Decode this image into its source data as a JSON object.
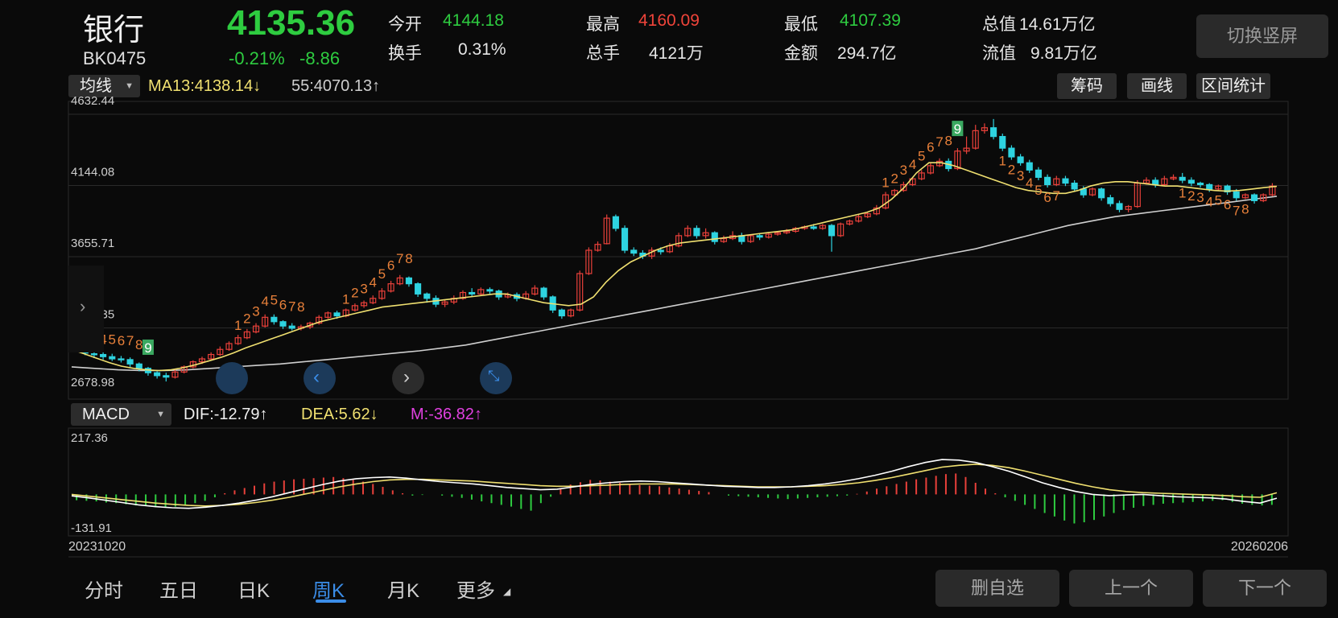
{
  "header": {
    "name": "银行",
    "code": "BK0475",
    "price": "4135.36",
    "change_pct": "-0.21%",
    "change_abs": "-8.86",
    "stats": [
      {
        "label": "今开",
        "value": "4144.18",
        "color": "#2ecc40"
      },
      {
        "label": "换手",
        "value": "0.31%",
        "color": "#e6e6e6"
      },
      {
        "label": "最高",
        "value": "4160.09",
        "color": "#f0443a"
      },
      {
        "label": "总手",
        "value": "4121万",
        "color": "#e6e6e6"
      },
      {
        "label": "最低",
        "value": "4107.39",
        "color": "#2ecc40"
      },
      {
        "label": "金额",
        "value": "294.7亿",
        "color": "#e6e6e6"
      },
      {
        "label": "总值",
        "value": "14.61万亿",
        "color": "#e6e6e6"
      },
      {
        "label": "流值",
        "value": "9.81万亿",
        "color": "#e6e6e6"
      }
    ],
    "rotate_button": "切换竖屏"
  },
  "toolbar": {
    "indicator_select": "均线",
    "ma13": "MA13:4138.14",
    "ma13_arrow": "↓",
    "ma55": "55:4070.13",
    "ma55_arrow": "↑",
    "buttons": [
      "筹码",
      "画线",
      "区间统计"
    ]
  },
  "macd_toolbar": {
    "select": "MACD",
    "dif": "DIF:-12.79",
    "dif_arrow": "↑",
    "dea": "DEA:5.62",
    "dea_arrow": "↓",
    "m": "M:-36.82",
    "m_arrow": "↑"
  },
  "nav": {
    "tabs": [
      "分时",
      "五日",
      "日K",
      "周K",
      "月K",
      "更多"
    ],
    "active": "周K",
    "buttons": [
      "删自选",
      "上一个",
      "下一个"
    ]
  },
  "colors": {
    "up": "#e8403a",
    "down": "#2ed3e0",
    "ma13": "#f0e070",
    "ma55": "#cfcfcf",
    "dif": "#ffffff",
    "dea": "#f0e070",
    "macd_up": "#e8403a",
    "macd_down": "#2ecc40",
    "magenta": "#e040e0",
    "yellow": "#f0e070"
  },
  "chart_data": [
    {
      "type": "candlestick",
      "title": "",
      "y_ticks": [
        "4632.44",
        "4144.08",
        "3655.71",
        "3167.35",
        "2678.98"
      ],
      "ylim": [
        2678.98,
        4632.44
      ],
      "x_start": "20231020",
      "x_end": "20260206",
      "grid": true,
      "series": [
        {
          "name": "MA13",
          "value": 4138.14
        },
        {
          "name": "55",
          "value": 4070.13
        }
      ],
      "candles_ohlc": [
        [
          3060,
          3040,
          3000,
          3070
        ],
        [
          3030,
          2995,
          2980,
          3045
        ],
        [
          2990,
          2985,
          2960,
          3010
        ],
        [
          2985,
          2970,
          2950,
          3000
        ],
        [
          2970,
          2955,
          2940,
          2990
        ],
        [
          2955,
          2950,
          2930,
          2975
        ],
        [
          2950,
          2920,
          2900,
          2965
        ],
        [
          2920,
          2890,
          2870,
          2930
        ],
        [
          2890,
          2860,
          2840,
          2900
        ],
        [
          2860,
          2840,
          2820,
          2870
        ],
        [
          2840,
          2830,
          2800,
          2860
        ],
        [
          2830,
          2865,
          2820,
          2880
        ],
        [
          2865,
          2900,
          2855,
          2910
        ],
        [
          2900,
          2935,
          2890,
          2945
        ],
        [
          2935,
          2955,
          2920,
          2970
        ],
        [
          2955,
          2985,
          2945,
          3000
        ],
        [
          2985,
          3020,
          2975,
          3040
        ],
        [
          3020,
          3060,
          3010,
          3075
        ],
        [
          3060,
          3100,
          3050,
          3120
        ],
        [
          3100,
          3140,
          3090,
          3160
        ],
        [
          3140,
          3180,
          3130,
          3200
        ],
        [
          3180,
          3240,
          3170,
          3260
        ],
        [
          3240,
          3210,
          3190,
          3260
        ],
        [
          3210,
          3180,
          3160,
          3220
        ],
        [
          3180,
          3165,
          3150,
          3200
        ],
        [
          3165,
          3175,
          3150,
          3190
        ],
        [
          3175,
          3200,
          3160,
          3210
        ],
        [
          3200,
          3240,
          3190,
          3255
        ],
        [
          3240,
          3270,
          3230,
          3280
        ],
        [
          3270,
          3250,
          3230,
          3285
        ],
        [
          3250,
          3290,
          3240,
          3300
        ],
        [
          3290,
          3320,
          3280,
          3335
        ],
        [
          3320,
          3340,
          3305,
          3355
        ],
        [
          3340,
          3370,
          3330,
          3390
        ],
        [
          3370,
          3420,
          3360,
          3440
        ],
        [
          3420,
          3470,
          3410,
          3490
        ],
        [
          3470,
          3510,
          3460,
          3530
        ],
        [
          3510,
          3470,
          3450,
          3520
        ],
        [
          3470,
          3400,
          3380,
          3480
        ],
        [
          3400,
          3370,
          3340,
          3410
        ],
        [
          3370,
          3330,
          3310,
          3390
        ],
        [
          3330,
          3345,
          3310,
          3360
        ],
        [
          3345,
          3370,
          3330,
          3390
        ],
        [
          3370,
          3410,
          3360,
          3425
        ],
        [
          3410,
          3400,
          3380,
          3440
        ],
        [
          3400,
          3430,
          3390,
          3445
        ],
        [
          3430,
          3420,
          3400,
          3445
        ],
        [
          3420,
          3380,
          3360,
          3430
        ],
        [
          3380,
          3395,
          3370,
          3410
        ],
        [
          3395,
          3370,
          3350,
          3410
        ],
        [
          3370,
          3400,
          3360,
          3420
        ],
        [
          3400,
          3440,
          3390,
          3460
        ],
        [
          3440,
          3380,
          3360,
          3450
        ],
        [
          3380,
          3290,
          3270,
          3390
        ],
        [
          3290,
          3250,
          3230,
          3300
        ],
        [
          3250,
          3290,
          3240,
          3300
        ],
        [
          3290,
          3540,
          3280,
          3560
        ],
        [
          3540,
          3700,
          3530,
          3720
        ],
        [
          3700,
          3740,
          3690,
          3760
        ],
        [
          3745,
          3920,
          3740,
          3945
        ],
        [
          3930,
          3850,
          3830,
          3945
        ],
        [
          3850,
          3700,
          3680,
          3870
        ],
        [
          3700,
          3680,
          3660,
          3720
        ],
        [
          3680,
          3660,
          3640,
          3700
        ],
        [
          3660,
          3700,
          3640,
          3720
        ],
        [
          3700,
          3690,
          3670,
          3720
        ],
        [
          3690,
          3730,
          3680,
          3750
        ],
        [
          3730,
          3800,
          3720,
          3820
        ],
        [
          3800,
          3850,
          3790,
          3870
        ],
        [
          3850,
          3800,
          3780,
          3870
        ],
        [
          3800,
          3820,
          3780,
          3850
        ],
        [
          3820,
          3760,
          3740,
          3830
        ],
        [
          3760,
          3780,
          3750,
          3800
        ],
        [
          3780,
          3800,
          3770,
          3830
        ],
        [
          3800,
          3760,
          3740,
          3820
        ],
        [
          3760,
          3800,
          3750,
          3810
        ],
        [
          3800,
          3790,
          3770,
          3815
        ],
        [
          3790,
          3810,
          3780,
          3825
        ],
        [
          3810,
          3820,
          3800,
          3830
        ],
        [
          3820,
          3830,
          3810,
          3845
        ],
        [
          3830,
          3850,
          3820,
          3860
        ],
        [
          3850,
          3860,
          3840,
          3870
        ],
        [
          3860,
          3850,
          3840,
          3880
        ],
        [
          3850,
          3870,
          3840,
          3880
        ],
        [
          3870,
          3800,
          3690,
          3880
        ],
        [
          3800,
          3880,
          3790,
          3890
        ],
        [
          3880,
          3900,
          3870,
          3910
        ],
        [
          3900,
          3930,
          3890,
          3945
        ],
        [
          3930,
          3950,
          3920,
          3960
        ],
        [
          3950,
          3990,
          3940,
          4010
        ],
        [
          3990,
          4080,
          3980,
          4100
        ],
        [
          4080,
          4110,
          4070,
          4120
        ],
        [
          4110,
          4150,
          4100,
          4170
        ],
        [
          4150,
          4190,
          4140,
          4200
        ],
        [
          4190,
          4230,
          4180,
          4250
        ],
        [
          4230,
          4280,
          4220,
          4300
        ],
        [
          4280,
          4310,
          4270,
          4330
        ],
        [
          4310,
          4260,
          4240,
          4330
        ],
        [
          4260,
          4380,
          4250,
          4400
        ],
        [
          4380,
          4400,
          4360,
          4480
        ],
        [
          4400,
          4520,
          4390,
          4560
        ],
        [
          4520,
          4540,
          4500,
          4570
        ],
        [
          4540,
          4480,
          4460,
          4600
        ],
        [
          4480,
          4400,
          4380,
          4500
        ],
        [
          4400,
          4340,
          4320,
          4420
        ],
        [
          4340,
          4300,
          4280,
          4360
        ],
        [
          4300,
          4250,
          4230,
          4320
        ],
        [
          4250,
          4200,
          4180,
          4270
        ],
        [
          4200,
          4150,
          4130,
          4220
        ],
        [
          4150,
          4190,
          4140,
          4210
        ],
        [
          4190,
          4160,
          4140,
          4210
        ],
        [
          4160,
          4120,
          4100,
          4180
        ],
        [
          4120,
          4080,
          4060,
          4140
        ],
        [
          4080,
          4120,
          4070,
          4130
        ],
        [
          4120,
          4060,
          4040,
          4130
        ],
        [
          4060,
          4020,
          4000,
          4080
        ],
        [
          4020,
          3980,
          3960,
          4040
        ],
        [
          3980,
          4000,
          3960,
          4010
        ],
        [
          4000,
          4160,
          3990,
          4180
        ],
        [
          4160,
          4180,
          4150,
          4200
        ],
        [
          4180,
          4150,
          4130,
          4200
        ],
        [
          4150,
          4190,
          4140,
          4210
        ],
        [
          4190,
          4200,
          4180,
          4220
        ],
        [
          4200,
          4180,
          4160,
          4230
        ],
        [
          4180,
          4160,
          4140,
          4200
        ],
        [
          4160,
          4150,
          4130,
          4170
        ],
        [
          4150,
          4120,
          4100,
          4160
        ],
        [
          4120,
          4140,
          4110,
          4150
        ],
        [
          4140,
          4100,
          4080,
          4150
        ],
        [
          4100,
          4060,
          4040,
          4120
        ],
        [
          4060,
          4080,
          4050,
          4090
        ],
        [
          4080,
          4040,
          4020,
          4090
        ],
        [
          4040,
          4080,
          4030,
          4090
        ],
        [
          4080,
          4140,
          4070,
          4160
        ]
      ],
      "ma13_curve": [
        3020,
        2990,
        2960,
        2930,
        2905,
        2890,
        2880,
        2875,
        2880,
        2895,
        2915,
        2940,
        2965,
        2995,
        3030,
        3060,
        3090,
        3120,
        3150,
        3180,
        3210,
        3230,
        3250,
        3270,
        3290,
        3310,
        3320,
        3330,
        3340,
        3350,
        3360,
        3370,
        3380,
        3390,
        3400,
        3400,
        3380,
        3360,
        3340,
        3330,
        3320,
        3330,
        3380,
        3480,
        3560,
        3620,
        3660,
        3700,
        3730,
        3750,
        3760,
        3770,
        3780,
        3790,
        3800,
        3810,
        3820,
        3830,
        3840,
        3860,
        3880,
        3900,
        3920,
        3940,
        3960,
        3990,
        4050,
        4130,
        4230,
        4300,
        4300,
        4280,
        4250,
        4220,
        4190,
        4160,
        4130,
        4110,
        4100,
        4090,
        4090,
        4110,
        4140,
        4160,
        4170,
        4170,
        4160,
        4150,
        4140,
        4140,
        4130,
        4120,
        4110,
        4105,
        4110,
        4120,
        4130,
        4138
      ],
      "ma55_curve": [
        2900,
        2890,
        2880,
        2875,
        2875,
        2880,
        2890,
        2900,
        2910,
        2920,
        2935,
        2950,
        2965,
        2980,
        2995,
        3010,
        3030,
        3050,
        3080,
        3110,
        3140,
        3170,
        3200,
        3230,
        3260,
        3290,
        3320,
        3350,
        3380,
        3410,
        3440,
        3470,
        3500,
        3530,
        3560,
        3590,
        3620,
        3650,
        3680,
        3710,
        3750,
        3790,
        3830,
        3870,
        3900,
        3930,
        3950,
        3970,
        3990,
        4010,
        4030,
        4050,
        4070
      ],
      "annotations": [
        "1",
        "2",
        "3",
        "4",
        "5",
        "6",
        "7",
        "8",
        "9"
      ]
    },
    {
      "type": "bar+line",
      "title": "MACD",
      "y_ticks": [
        "217.36",
        "-131.91"
      ],
      "ylim": [
        -131.91,
        217.36
      ],
      "series": [
        {
          "name": "DIF",
          "value": -12.79
        },
        {
          "name": "DEA",
          "value": 5.62
        },
        {
          "name": "M",
          "value": -36.82
        }
      ],
      "macd_hist": [
        -20,
        -22,
        -24,
        -28,
        -30,
        -34,
        -38,
        -40,
        -44,
        -46,
        -42,
        -36,
        -30,
        -22,
        -10,
        4,
        14,
        22,
        30,
        38,
        44,
        48,
        52,
        54,
        56,
        58,
        60,
        56,
        50,
        44,
        36,
        26,
        14,
        4,
        -4,
        -2,
        0,
        -4,
        -8,
        -12,
        -18,
        -24,
        -30,
        -36,
        -42,
        -50,
        -56,
        -30,
        -8,
        22,
        34,
        42,
        50,
        48,
        44,
        40,
        36,
        32,
        30,
        28,
        24,
        20,
        16,
        12,
        8,
        0,
        -4,
        -6,
        -8,
        -10,
        -12,
        -14,
        -16,
        -14,
        -12,
        -10,
        -8,
        -6,
        -4,
        2,
        10,
        20,
        28,
        36,
        44,
        52,
        58,
        64,
        70,
        72,
        60,
        40,
        20,
        4,
        -10,
        -22,
        -36,
        -50,
        -64,
        -76,
        -90,
        -100,
        -96,
        -88,
        -76,
        -64,
        -54,
        -46,
        -40,
        -36,
        -32,
        -30,
        -28,
        -26,
        -24,
        -22,
        -20,
        -26,
        -32,
        -36,
        -38,
        -36
      ],
      "dif_curve": [
        -5,
        -12,
        -20,
        -28,
        -36,
        -42,
        -46,
        -48,
        -44,
        -38,
        -30,
        -20,
        -8,
        6,
        20,
        34,
        46,
        54,
        58,
        60,
        56,
        50,
        44,
        40,
        36,
        30,
        24,
        20,
        16,
        18,
        26,
        34,
        40,
        44,
        46,
        44,
        40,
        36,
        32,
        28,
        26,
        24,
        24,
        26,
        30,
        36,
        44,
        54,
        66,
        80,
        96,
        110,
        120,
        118,
        110,
        96,
        80,
        60,
        40,
        24,
        10,
        0,
        -4,
        -2,
        0,
        -4,
        -8,
        -10,
        -12,
        -16,
        -24,
        -30,
        -13
      ],
      "dea_curve": [
        0,
        -6,
        -12,
        -18,
        -24,
        -30,
        -34,
        -38,
        -40,
        -38,
        -34,
        -28,
        -20,
        -10,
        2,
        14,
        26,
        36,
        44,
        50,
        52,
        52,
        50,
        48,
        46,
        42,
        38,
        34,
        30,
        28,
        28,
        30,
        32,
        34,
        36,
        36,
        36,
        34,
        32,
        30,
        28,
        26,
        26,
        26,
        28,
        30,
        34,
        40,
        48,
        58,
        70,
        82,
        94,
        100,
        104,
        100,
        92,
        80,
        66,
        52,
        38,
        26,
        16,
        10,
        6,
        4,
        2,
        0,
        -2,
        -4,
        -8,
        -10,
        5.6
      ]
    }
  ]
}
